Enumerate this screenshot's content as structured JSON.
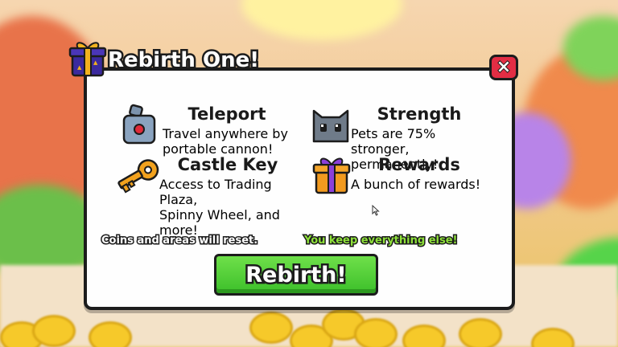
{
  "dialog": {
    "title": "Rebirth One!",
    "close_label": "×"
  },
  "perks": [
    {
      "title": "Teleport",
      "description": [
        "Travel anywhere by",
        "portable cannon!"
      ],
      "icon": "teleport-device-icon"
    },
    {
      "title": "Strength",
      "description": [
        "Pets are 75% stronger,",
        "permanently!"
      ],
      "icon": "cat-pet-icon"
    },
    {
      "title": "Castle Key",
      "description": [
        "Access to Trading Plaza,",
        "Spinny Wheel, and more!"
      ],
      "icon": "key-icon"
    },
    {
      "title": "Rewards",
      "description": [
        "A bunch of rewards!"
      ],
      "icon": "gift-box-icon"
    }
  ],
  "footer": {
    "reset_note": "Coins and areas will reset.",
    "keep_note": "You keep everything else!",
    "rebirth_button": "Rebirth!"
  },
  "colors": {
    "close_red": "#e32d44",
    "button_green": "#3cbf2a",
    "keep_green": "#8ee03a",
    "gift_purple": "#3b2a9e",
    "gift_orange": "#f29a1e"
  }
}
